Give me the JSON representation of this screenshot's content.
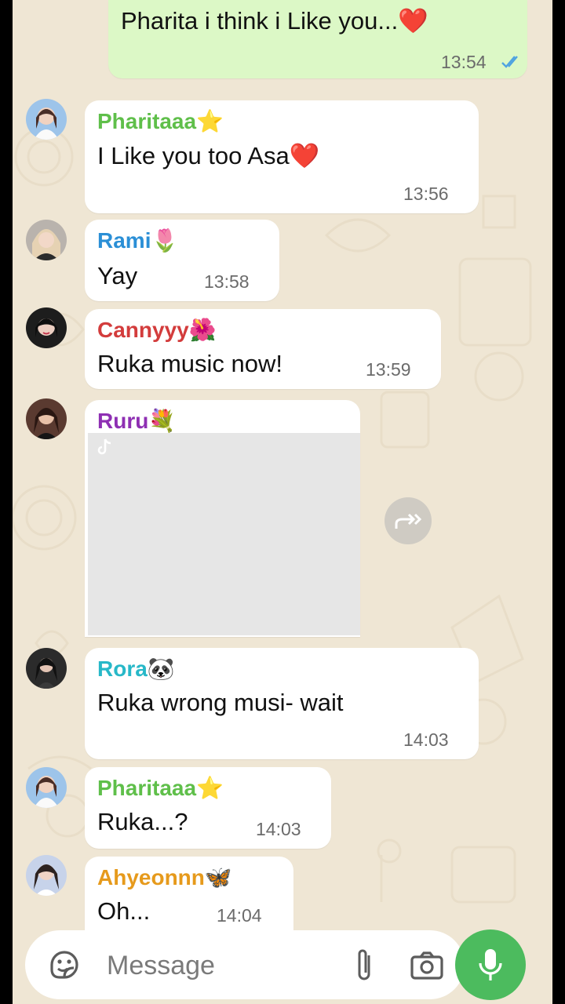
{
  "messages": [
    {
      "direction": "outgoing",
      "text": "Pharita i think i Like you...",
      "text_emoji": "❤️",
      "time": "13:54",
      "status": "read"
    },
    {
      "direction": "incoming",
      "sender": "Pharitaaa",
      "sender_emoji": "⭐",
      "sender_color": "#5fbf4a",
      "text": "I Like you too Asa",
      "text_emoji": "❤️",
      "time": "13:56"
    },
    {
      "direction": "incoming",
      "sender": "Rami",
      "sender_emoji": "🌷",
      "sender_color": "#2b8fd6",
      "text": "Yay",
      "time": "13:58"
    },
    {
      "direction": "incoming",
      "sender": "Cannyyy",
      "sender_emoji": "🌺",
      "sender_color": "#d33c3c",
      "text": "Ruka music now!",
      "time": "13:59"
    },
    {
      "direction": "incoming",
      "sender": "Ruru",
      "sender_emoji": "💐",
      "sender_color": "#8e2fb3",
      "attachment": "video"
    },
    {
      "direction": "incoming",
      "sender": "Rora",
      "sender_emoji": "🐼",
      "sender_color": "#27b8c8",
      "text": "Ruka wrong musi- wait",
      "time": "14:03"
    },
    {
      "direction": "incoming",
      "sender": "Pharitaaa",
      "sender_emoji": "⭐",
      "sender_color": "#5fbf4a",
      "text": "Ruka...?",
      "time": "14:03"
    },
    {
      "direction": "incoming",
      "sender": "Ahyeonnn",
      "sender_emoji": "🦋",
      "sender_color": "#e69a1c",
      "text": "Oh...",
      "time": "14:04"
    }
  ],
  "input": {
    "placeholder": "Message",
    "icons": [
      "sticker-icon",
      "attach-icon",
      "camera-icon",
      "mic-icon"
    ]
  },
  "colors": {
    "background": "#efe6d4",
    "outgoing_bubble": "#dcf8c6",
    "incoming_bubble": "#ffffff",
    "read_ticks": "#4fa3e0",
    "mic_button": "#4cbb5e"
  }
}
